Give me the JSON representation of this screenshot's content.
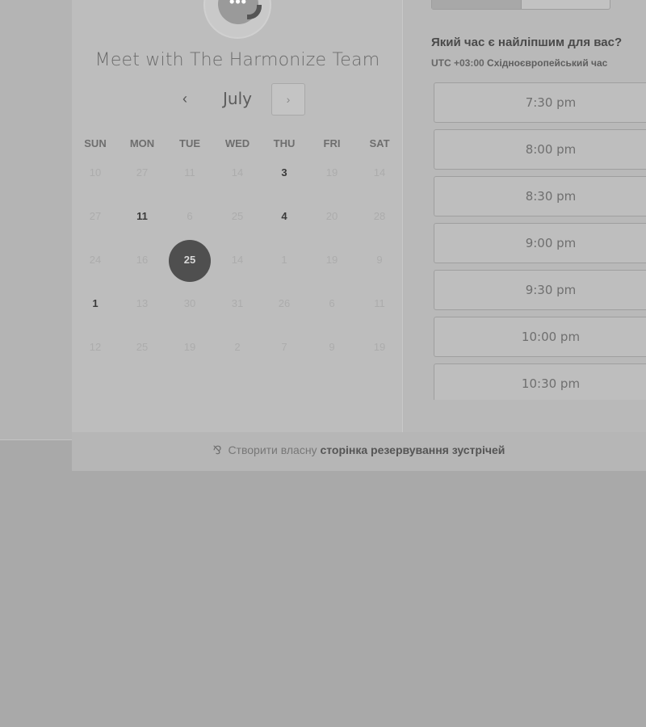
{
  "meeting": {
    "title": "Meet with The Harmonize Team"
  },
  "calendar": {
    "month": "July",
    "prev_icon": "chevron-left-icon",
    "next_icon": "chevron-right-icon",
    "weekdays": [
      "SUN",
      "MON",
      "TUE",
      "WED",
      "THU",
      "FRI",
      "SAT"
    ],
    "weeks": [
      [
        {
          "d": "10",
          "s": "muted"
        },
        {
          "d": "27",
          "s": "muted"
        },
        {
          "d": "11",
          "s": "muted"
        },
        {
          "d": "14",
          "s": "muted"
        },
        {
          "d": "3",
          "s": "avail"
        },
        {
          "d": "19",
          "s": "muted"
        },
        {
          "d": "14",
          "s": "muted"
        }
      ],
      [
        {
          "d": "27",
          "s": "muted"
        },
        {
          "d": "11",
          "s": "avail"
        },
        {
          "d": "6",
          "s": "muted"
        },
        {
          "d": "25",
          "s": "muted"
        },
        {
          "d": "4",
          "s": "avail"
        },
        {
          "d": "20",
          "s": "muted"
        },
        {
          "d": "28",
          "s": "muted"
        }
      ],
      [
        {
          "d": "24",
          "s": "muted"
        },
        {
          "d": "16",
          "s": "muted"
        },
        {
          "d": "25",
          "s": "selected"
        },
        {
          "d": "14",
          "s": "muted"
        },
        {
          "d": "1",
          "s": "muted"
        },
        {
          "d": "19",
          "s": "muted"
        },
        {
          "d": "9",
          "s": "muted"
        }
      ],
      [
        {
          "d": "1",
          "s": "avail"
        },
        {
          "d": "13",
          "s": "muted"
        },
        {
          "d": "30",
          "s": "muted"
        },
        {
          "d": "31",
          "s": "muted"
        },
        {
          "d": "26",
          "s": "muted"
        },
        {
          "d": "6",
          "s": "muted"
        },
        {
          "d": "11",
          "s": "muted"
        }
      ],
      [
        {
          "d": "12",
          "s": "muted"
        },
        {
          "d": "25",
          "s": "muted"
        },
        {
          "d": "19",
          "s": "muted"
        },
        {
          "d": "2",
          "s": "muted"
        },
        {
          "d": "7",
          "s": "muted"
        },
        {
          "d": "9",
          "s": "muted"
        },
        {
          "d": "19",
          "s": "muted"
        }
      ]
    ],
    "selected_color": "#4f4f4f"
  },
  "times": {
    "question": "Який час є найліпшим для вас?",
    "tz_offset": "UTC +03:00",
    "tz_name": "Східноєвропейський час",
    "slots": [
      "7:30 pm",
      "8:00 pm",
      "8:30 pm",
      "9:00 pm",
      "9:30 pm",
      "10:00 pm",
      "10:30 pm"
    ]
  },
  "footer": {
    "icon": "hubspot-sprocket-icon",
    "prefix": "Створити власну",
    "link": "сторінка резервування зустрічей"
  }
}
